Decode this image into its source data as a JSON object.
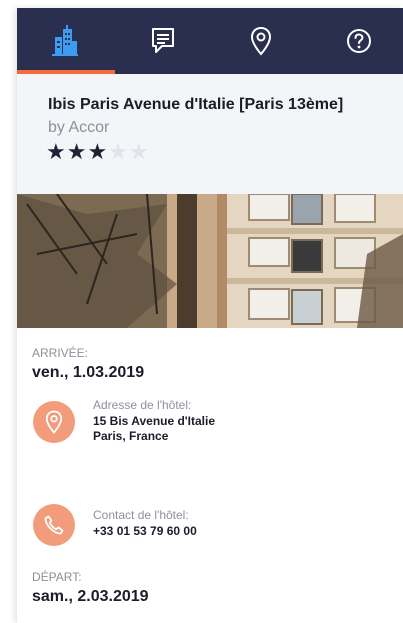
{
  "tabs": [
    {
      "name": "hotel",
      "icon": "building-icon",
      "active": true
    },
    {
      "name": "messages",
      "icon": "chat-icon",
      "active": false
    },
    {
      "name": "location",
      "icon": "location-pin-icon",
      "active": false
    },
    {
      "name": "help",
      "icon": "help-icon",
      "active": false
    }
  ],
  "hotel": {
    "title": "Ibis Paris Avenue d'Italie [Paris 13ème]",
    "brand": "by Accor",
    "rating": 3,
    "max_rating": 5
  },
  "checkin": {
    "label": "ARRIVÉE:",
    "date": "ven., 1.03.2019"
  },
  "address": {
    "label": "Adresse de l'hôtel:",
    "line1": "15 Bis Avenue d'Italie",
    "line2": "Paris, France",
    "icon": "location-pin-icon"
  },
  "contact": {
    "label": "Contact de l'hôtel:",
    "phone": "+33 01 53 79 60 00",
    "icon": "phone-icon"
  },
  "checkout": {
    "label": "DÉPART:",
    "date": "sam., 2.03.2019"
  },
  "colors": {
    "nav_bg": "#2a2f50",
    "accent": "#f26b3a",
    "icon_active": "#3d9bf2",
    "circle": "#f29c7b",
    "header_bg": "#f4f5f9"
  }
}
